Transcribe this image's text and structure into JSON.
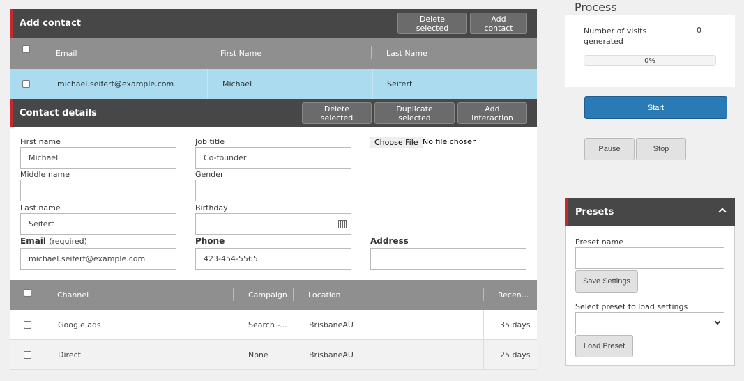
{
  "add_contact": {
    "title": "Add contact",
    "delete_label": "Delete selected",
    "add_label": "Add contact",
    "columns": {
      "email": "Email",
      "first": "First Name",
      "last": "Last Name"
    },
    "rows": [
      {
        "email": "michael.seifert@example.com",
        "first": "Michael",
        "last": "Seifert"
      }
    ]
  },
  "details": {
    "title": "Contact details",
    "delete_label": "Delete selected",
    "duplicate_label": "Duplicate selected",
    "add_interaction_label": "Add Interaction",
    "first_name_label": "First name",
    "first_name_value": "Michael",
    "middle_name_label": "Middle name",
    "middle_name_value": "",
    "last_name_label": "Last name",
    "last_name_value": "Seifert",
    "job_title_label": "Job title",
    "job_title_value": "Co-founder",
    "gender_label": "Gender",
    "gender_value": "",
    "birthday_label": "Birthday",
    "birthday_value": "",
    "file_button": "Choose File",
    "file_status": "No file chosen",
    "email_label": "Email",
    "email_required": "(required)",
    "email_value": "michael.seifert@example.com",
    "phone_label": "Phone",
    "phone_value": "423-454-5565",
    "address_label": "Address",
    "address_value": ""
  },
  "interactions": {
    "columns": {
      "channel": "Channel",
      "campaign": "Campaign",
      "location": "Location",
      "recency": "Recen..."
    },
    "rows": [
      {
        "channel": "Google ads",
        "campaign": "Search -...",
        "location": "BrisbaneAU",
        "recency": "35 days"
      },
      {
        "channel": "Direct",
        "campaign": "None",
        "location": "BrisbaneAU",
        "recency": "25 days"
      }
    ]
  },
  "process": {
    "title": "Process",
    "visits_label": "Number of visits generated",
    "visits_value": "0",
    "progress_percent": 0,
    "progress_label": "0%",
    "start_label": "Start",
    "pause_label": "Pause",
    "stop_label": "Stop"
  },
  "presets": {
    "title": "Presets",
    "name_label": "Preset name",
    "name_value": "",
    "save_label": "Save Settings",
    "select_label": "Select preset to load settings",
    "select_value": "",
    "load_label": "Load Preset"
  },
  "colors": {
    "accent": "#c9272e",
    "header_bg": "#474747",
    "selected_row": "#abdbee",
    "start_button": "#2a7ab5"
  },
  "icons": [
    "calendar-icon",
    "chevron-up-icon",
    "chevron-down-icon"
  ]
}
